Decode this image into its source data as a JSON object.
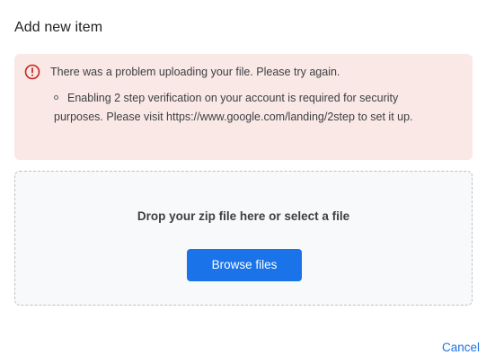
{
  "dialog": {
    "title": "Add new item"
  },
  "error": {
    "message": "There was a problem uploading your file. Please try again.",
    "detail": "Enabling 2 step verification on your account is required for security purposes. Please visit https://www.google.com/landing/2step to set it up.",
    "icon": "error-alert-icon",
    "background_color": "#fae8e6",
    "icon_color": "#c5221f"
  },
  "drop_zone": {
    "text": "Drop your zip file here or select a file",
    "browse_label": "Browse files"
  },
  "footer": {
    "cancel_label": "Cancel"
  },
  "colors": {
    "accent": "#1a73e8"
  }
}
